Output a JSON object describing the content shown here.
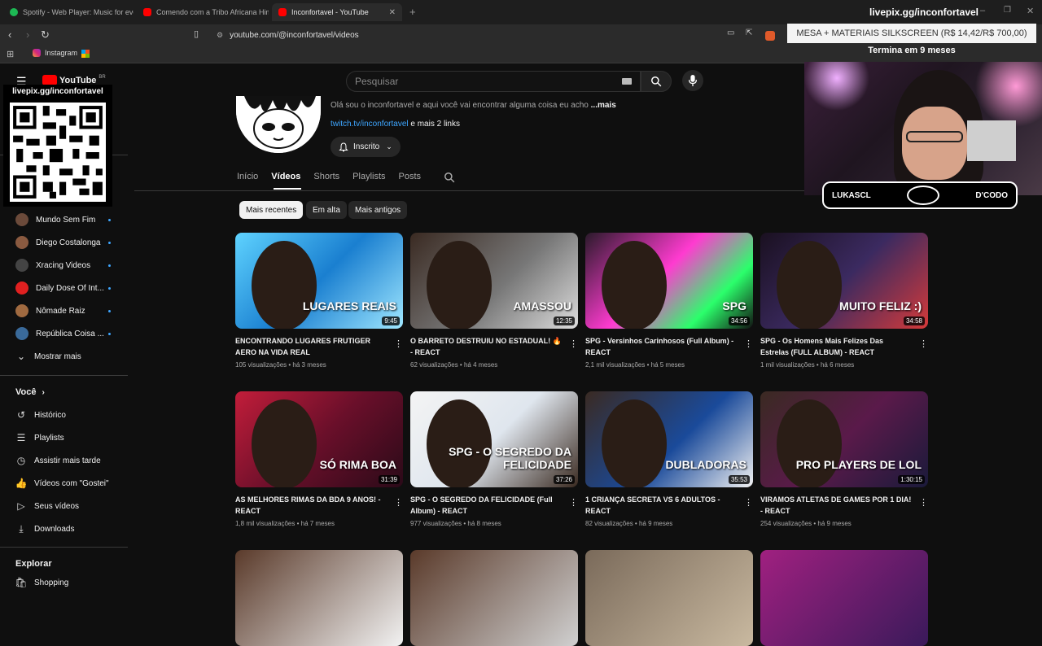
{
  "browser": {
    "tabs": [
      {
        "label": "Spotify - Web Player: Music for every",
        "color": "#1db954"
      },
      {
        "label": "Comendo com a Tribo Africana Himb",
        "color": "#ff0000"
      },
      {
        "label": "Inconfortavel - YouTube",
        "color": "#ff0000"
      }
    ],
    "url": "youtube.com/@inconfortavel/videos",
    "bookmark_instagram": "Instagram"
  },
  "stream_overlay": {
    "title": "livepix.gg/inconfortavel",
    "promo": "MESA + MATERIAIS SILKSCREEN (R$ 14,42/R$ 700,00)",
    "promo_sub": "Termina em 9 meses",
    "qr_label": "livepix.gg/inconfortavel",
    "nameplate_left": "LUKASCL",
    "nameplate_right": "D'CODO"
  },
  "youtube": {
    "logo": "YouTube",
    "region": "BR",
    "search_placeholder": "Pesquisar",
    "channel": {
      "description": "Olá sou o inconfortavel e aqui você vai encontrar alguma coisa eu acho",
      "more": "...mais",
      "link": "twitch.tv/inconfortavel",
      "more_links": "e mais 2 links",
      "subscribed": "Inscrito"
    },
    "tabs": [
      "Início",
      "Vídeos",
      "Shorts",
      "Playlists",
      "Posts"
    ],
    "chips": [
      "Mais recentes",
      "Em alta",
      "Mais antigos"
    ]
  },
  "sidebar": {
    "subscriptions": [
      {
        "label": "Mundo Sem Fim",
        "color": "#6b4a3a"
      },
      {
        "label": "Diego Costalonga",
        "color": "#8a5a40"
      },
      {
        "label": "Xracing Videos",
        "color": "#444"
      },
      {
        "label": "Daily Dose Of Int...",
        "color": "#e02020"
      },
      {
        "label": "Nômade Raiz",
        "color": "#a06a40"
      },
      {
        "label": "República Coisa ...",
        "color": "#3a6a9a"
      }
    ],
    "show_more": "Mostrar mais",
    "you_header": "Você",
    "you_items": [
      "Histórico",
      "Playlists",
      "Assistir mais tarde",
      "Vídeos com \"Gostei\"",
      "Seus vídeos",
      "Downloads"
    ],
    "explore_header": "Explorar",
    "explore_items": [
      "Shopping"
    ]
  },
  "videos": [
    {
      "title": "ENCONTRANDO LUGARES FRUTIGER AERO NA VIDA REAL",
      "views": "105 visualizações",
      "ago": "há 3 meses",
      "duration": "9:45",
      "thumb_text": "LUGARES REAIS",
      "bg": "linear-gradient(135deg,#5fd3ff,#1a7fd0 50%,#9fe7ff)"
    },
    {
      "title": "O BARRETO DESTRUIU NO ESTADUAL! 🔥 - REACT",
      "views": "62 visualizações",
      "ago": "há 4 meses",
      "duration": "12:35",
      "thumb_text": "AMASSOU",
      "bg": "linear-gradient(135deg,#3a2a22,#777 55%,#ddd)"
    },
    {
      "title": "SPG - Versinhos Carinhosos (Full Album) - REACT",
      "views": "2,1 mil visualizações",
      "ago": "há 5 meses",
      "duration": "34:56",
      "thumb_text": "SPG",
      "bg": "linear-gradient(135deg,#2a1a2a,#ff3bd0 45%,#2bff6b 75%,#111)"
    },
    {
      "title": "SPG - Os Homens Mais Felizes Das Estrelas (FULL ALBUM) - REACT",
      "views": "1 mil visualizações",
      "ago": "há 6 meses",
      "duration": "34:58",
      "thumb_text": "MUITO FELIZ :)",
      "bg": "linear-gradient(135deg,#1a1020,#3b2a60 50%,#d53a3a)"
    },
    {
      "title": "AS MELHORES RIMAS DA BDA 9 ANOS! - REACT",
      "views": "1,8 mil visualizações",
      "ago": "há 7 meses",
      "duration": "31:39",
      "thumb_text": "SÓ RIMA BOA",
      "bg": "linear-gradient(135deg,#c21d3a,#6a0f2a 50%,#2a0a18)"
    },
    {
      "title": "SPG - O SEGREDO DA FELICIDADE (Full Album) - REACT",
      "views": "977 visualizações",
      "ago": "há 8 meses",
      "duration": "37:26",
      "thumb_text": "SPG - O SEGREDO DA FELICIDADE",
      "bg": "linear-gradient(135deg,#f4f4f4,#dfe6ee 50%,#3a2a20)"
    },
    {
      "title": "1 CRIANÇA SECRETA VS 6 ADULTOS - REACT",
      "views": "82 visualizações",
      "ago": "há 9 meses",
      "duration": "35:53",
      "thumb_text": "DUBLADORAS",
      "bg": "linear-gradient(135deg,#3a2a22,#1a4a9a 55%,#f2f2f2)"
    },
    {
      "title": "VIRAMOS ATLETAS DE GAMES POR 1 DIA! - REACT",
      "views": "254 visualizações",
      "ago": "há 9 meses",
      "duration": "1:30:15",
      "thumb_text": "PRO PLAYERS DE LOL",
      "bg": "linear-gradient(135deg,#3a2a22,#5a1a4a 50%,#1a1a3a)"
    }
  ],
  "next_row_bgs": [
    "linear-gradient(135deg,#5a3a2a,#f2f2f2)",
    "linear-gradient(135deg,#5a3a2a,#d0d0d0)",
    "linear-gradient(135deg,#7a6a5a,#c9b9a0)",
    "linear-gradient(135deg,#a02080,#3a1a5a)"
  ]
}
